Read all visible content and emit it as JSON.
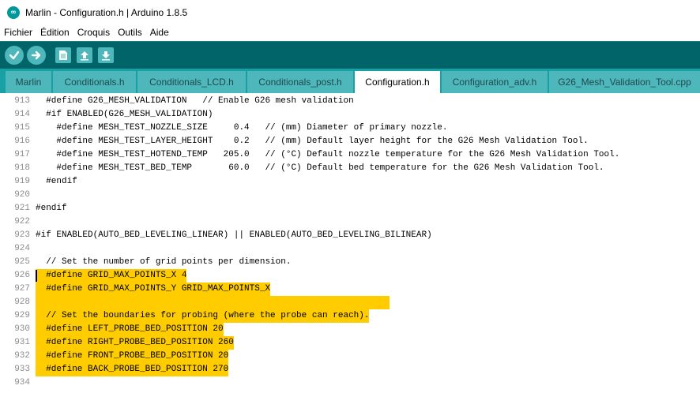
{
  "window": {
    "title": "Marlin - Configuration.h | Arduino 1.8.5",
    "logo_text": "∞"
  },
  "menu": [
    "Fichier",
    "Édition",
    "Croquis",
    "Outils",
    "Aide"
  ],
  "toolbar": {
    "buttons": [
      "verify-icon",
      "upload-icon",
      "new-icon",
      "open-icon",
      "save-icon"
    ],
    "accent_color": "#006468"
  },
  "tabs": [
    {
      "label": "Marlin",
      "active": false
    },
    {
      "label": "Conditionals.h",
      "active": false
    },
    {
      "label": "Conditionals_LCD.h",
      "active": false
    },
    {
      "label": "Conditionals_post.h",
      "active": false
    },
    {
      "label": "Configuration.h",
      "active": true
    },
    {
      "label": "Configuration_adv.h",
      "active": false
    },
    {
      "label": "G26_Mesh_Validation_Tool.cpp",
      "active": false
    }
  ],
  "editor": {
    "highlight_color": "#ffcc00",
    "lines": [
      {
        "num": "913",
        "text": "  #define G26_MESH_VALIDATION   // Enable G26 mesh validation",
        "highlight": false
      },
      {
        "num": "914",
        "text": "  #if ENABLED(G26_MESH_VALIDATION)",
        "highlight": false
      },
      {
        "num": "915",
        "text": "    #define MESH_TEST_NOZZLE_SIZE     0.4   // (mm) Diameter of primary nozzle.",
        "highlight": false
      },
      {
        "num": "916",
        "text": "    #define MESH_TEST_LAYER_HEIGHT    0.2   // (mm) Default layer height for the G26 Mesh Validation Tool.",
        "highlight": false
      },
      {
        "num": "917",
        "text": "    #define MESH_TEST_HOTEND_TEMP   205.0   // (°C) Default nozzle temperature for the G26 Mesh Validation Tool.",
        "highlight": false
      },
      {
        "num": "918",
        "text": "    #define MESH_TEST_BED_TEMP       60.0   // (°C) Default bed temperature for the G26 Mesh Validation Tool.",
        "highlight": false
      },
      {
        "num": "919",
        "text": "  #endif",
        "highlight": false
      },
      {
        "num": "920",
        "text": "",
        "highlight": false
      },
      {
        "num": "921",
        "text": "#endif",
        "highlight": false
      },
      {
        "num": "922",
        "text": "",
        "highlight": false
      },
      {
        "num": "923",
        "text": "#if ENABLED(AUTO_BED_LEVELING_LINEAR) || ENABLED(AUTO_BED_LEVELING_BILINEAR)",
        "highlight": false
      },
      {
        "num": "924",
        "text": "",
        "highlight": false
      },
      {
        "num": "925",
        "text": "  // Set the number of grid points per dimension.",
        "highlight": false
      },
      {
        "num": "926",
        "text": "  #define GRID_MAX_POINTS_X 4",
        "highlight": true
      },
      {
        "num": "927",
        "text": "  #define GRID_MAX_POINTS_Y GRID_MAX_POINTS_X",
        "highlight": true
      },
      {
        "num": "928",
        "text": "",
        "highlight": true
      },
      {
        "num": "929",
        "text": "  // Set the boundaries for probing (where the probe can reach).",
        "highlight": true
      },
      {
        "num": "930",
        "text": "  #define LEFT_PROBE_BED_POSITION 20",
        "highlight": true
      },
      {
        "num": "931",
        "text": "  #define RIGHT_PROBE_BED_POSITION 260",
        "highlight": true
      },
      {
        "num": "932",
        "text": "  #define FRONT_PROBE_BED_POSITION 20",
        "highlight": true
      },
      {
        "num": "933",
        "text": "  #define BACK_PROBE_BED_POSITION 270",
        "highlight": true
      },
      {
        "num": "934",
        "text": "",
        "highlight": false
      }
    ]
  }
}
